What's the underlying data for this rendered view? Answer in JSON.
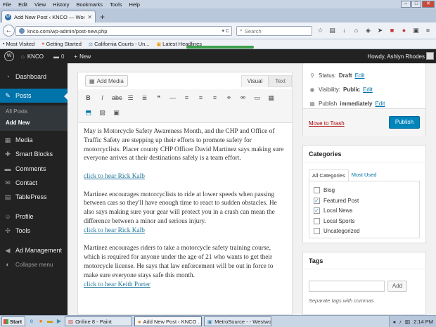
{
  "browser": {
    "menu": [
      "File",
      "Edit",
      "View",
      "History",
      "Bookmarks",
      "Tools",
      "Help"
    ],
    "tab_title": "Add New Post ‹ KNCO — WordPress",
    "new_tab": "+",
    "url": "knco.com/wp-admin/post-new.php",
    "search_placeholder": "Search",
    "bookmarks": [
      "Most Visited",
      "Getting Started",
      "California Courts - Un...",
      "Latest Headlines"
    ]
  },
  "adminbar": {
    "site": "KNCO",
    "comments": "0",
    "new": "New",
    "howdy": "Howdy, Ashlyn Rhodes"
  },
  "sidebar": {
    "items": [
      "Dashboard",
      "Posts",
      "Media",
      "Smart Blocks",
      "Comments",
      "Contact",
      "TablePress",
      "Profile",
      "Tools",
      "Ad Management",
      "Collapse menu"
    ],
    "sub": [
      "All Posts",
      "Add New"
    ]
  },
  "editor": {
    "add_media": "Add Media",
    "tab_visual": "Visual",
    "tab_text": "Text",
    "p1": "May is Motorcycle Safety Awareness Month, and the CHP and Office of Traffic Safety are stepping up their efforts to promote safety for motorcyclists.  Placer county CHP Officer David Martinez says making sure everyone arrives at their destinations safely is a team effort.",
    "link1": "click to hear Rick Kalb",
    "p2": "Martinez encourages motorcyclists to ride at lower speeds when passing between cars so they'll have enough time to react to sudden obstacles.  He also says making sure your gear will protect you in a crash can mean the difference between a minor and serious injury.",
    "link2": "click to hear Rick Kalb",
    "p3": "Martinez encourages riders to take a motorcycle safety training course, which is required for anyone under the age of 21 who wants to get their motorcycle license.  He says that law enforcement will be out in force to make sure everyone stays safe this month.",
    "link3": "click to hear Keith Porter"
  },
  "publish": {
    "status_label": "Status:",
    "status_value": "Draft",
    "visibility_label": "Visibility:",
    "visibility_value": "Public",
    "publish_label": "Publish",
    "publish_value": "immediately",
    "edit": "Edit",
    "trash": "Move to Trash",
    "button": "Publish"
  },
  "categories": {
    "title": "Categories",
    "tab_all": "All Categories",
    "tab_used": "Most Used",
    "items": [
      {
        "label": "Blog",
        "checked": false
      },
      {
        "label": "Featured Post",
        "checked": true
      },
      {
        "label": "Local News",
        "checked": true
      },
      {
        "label": "Local Sports",
        "checked": false
      },
      {
        "label": "Uncategorized",
        "checked": false
      }
    ]
  },
  "tags": {
    "title": "Tags",
    "add": "Add",
    "help": "Separate tags with commas"
  },
  "taskbar": {
    "start": "Start",
    "tasks": [
      "Online 8 - Paint",
      "Add New Post ‹ KNCO ...",
      "MetroSource - - Westwo..."
    ],
    "clock": "2:14 PM"
  }
}
